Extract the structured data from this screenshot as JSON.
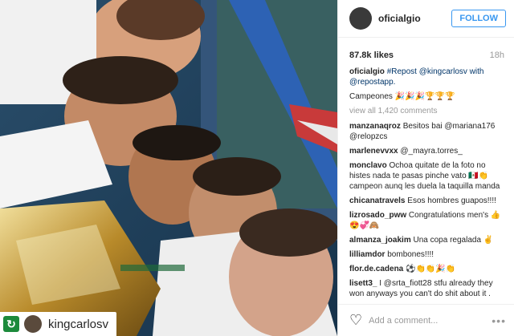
{
  "post": {
    "username": "oficialgio",
    "follow_label": "FOLLOW",
    "likes": "87.8k likes",
    "time": "18h",
    "caption_user": "oficialgio",
    "caption_text": "#Repost @kingcarlosv with @repostapp.",
    "caption_line2": "Campeones 🎉🎉🎉🏆🏆🏆",
    "view_all": "view all 1,420 comments",
    "add_comment_placeholder": "Add a comment...",
    "more_icon": "more-dots-icon",
    "like_icon": "heart-icon"
  },
  "photo": {
    "repost_user": "kingcarlosv",
    "repost_icon": "repost-icon"
  },
  "comments": [
    {
      "user": "manzanaqroz",
      "text": "Besitos bai @mariana176 @relopzcs"
    },
    {
      "user": "marlenevvxx",
      "text": "@_mayra.torres_"
    },
    {
      "user": "monclavo",
      "text": "Ochoa quitate de la foto no histes nada te pasas pinche vato 🇲🇽👏 campeon aunq les duela la taquilla manda"
    },
    {
      "user": "chicanatravels",
      "text": "Esos hombres guapos!!!!"
    },
    {
      "user": "lizrosado_pww",
      "text": "Congratulations men's 👍😍💞🙈"
    },
    {
      "user": "almanza_joakim",
      "text": "Una copa regalada ✌"
    },
    {
      "user": "lilliamdor",
      "text": "bombones!!!!"
    },
    {
      "user": "flor.de.cadena",
      "text": "⚽👏👏🎉👏"
    },
    {
      "user": "lisett3_",
      "text": "I @srta_fiott28 stfu already they won anyways you can't do shit about it ."
    }
  ]
}
